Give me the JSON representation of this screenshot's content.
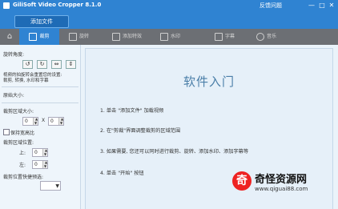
{
  "titlebar": {
    "title": "GiliSoft Video Cropper 8.1.0",
    "help": "反馈问题",
    "controls": [
      "—",
      "□",
      "✕"
    ]
  },
  "toolbar": {
    "add_button": "添加文件"
  },
  "tabs": [
    {
      "label": "裁剪",
      "active": true
    },
    {
      "label": "旋转",
      "active": false
    },
    {
      "label": "添加特效",
      "active": false
    },
    {
      "label": "水印",
      "active": false
    },
    {
      "label": "字幕",
      "active": false
    },
    {
      "label": "音乐",
      "active": false
    }
  ],
  "left_panel": {
    "rotate_title": "旋转角度:",
    "rotate_buttons": [
      "↺",
      "↻",
      "⇔",
      "⇕"
    ],
    "hint_line1": "视频的拍旋转会重置您的设置:",
    "hint_line2": "裁剪, 转换, 水印和字幕",
    "original_size": "原始大小:",
    "crop_size": "裁剪区域大小:",
    "width_val": "0",
    "height_val": "0",
    "times": "X",
    "keep_ratio": "保持宽高比",
    "crop_pos": "裁剪区域位置:",
    "top_label": "上:",
    "left_label": "左:",
    "top_val": "0",
    "left_val": "0",
    "crop_preset": "裁剪位置快捷预选:"
  },
  "main": {
    "title": "软件入门",
    "steps": [
      "1. 单击 \"添加文件\" 加载视频",
      "2. 在\"剪裁\"界面调整裁剪的区域范围",
      "3. 如果需要, 您还可以同时进行裁剪、旋转、添加水印、添加字幕等",
      "4. 单击 \"开始\" 按钮"
    ]
  },
  "watermark": {
    "logo_char": "奇",
    "text": "奇怪资源网",
    "url": "www.qiguai88.com"
  }
}
